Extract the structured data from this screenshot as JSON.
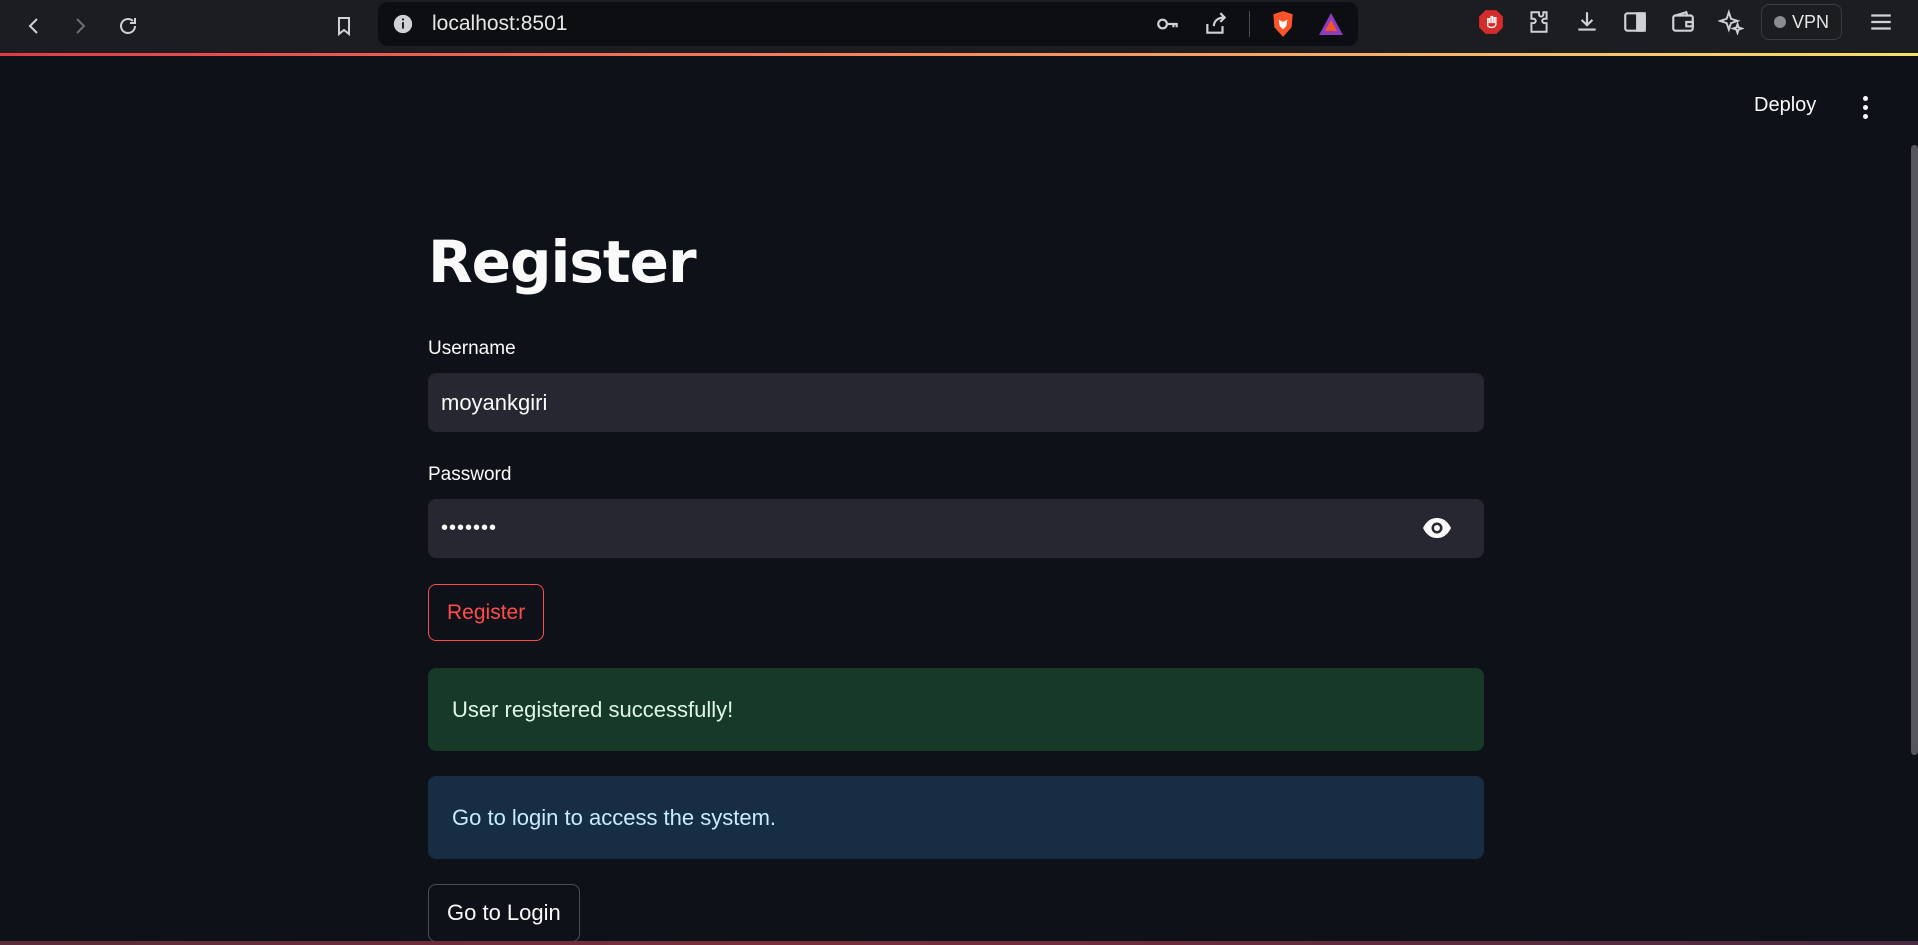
{
  "browser": {
    "url": "localhost:8501",
    "vpn_label": "VPN"
  },
  "header": {
    "deploy_label": "Deploy"
  },
  "page": {
    "title": "Register",
    "username_label": "Username",
    "username_value": "moyankgiri",
    "password_label": "Password",
    "password_masked": "•••••••",
    "register_button": "Register",
    "success_message": "User registered successfully!",
    "info_message": "Go to login to access the system.",
    "login_button": "Go to Login"
  },
  "colors": {
    "background": "#0e1117",
    "input_bg": "#262730",
    "primary_red": "#ff4b4b",
    "success_bg": "#173928",
    "info_bg": "#172d43"
  }
}
